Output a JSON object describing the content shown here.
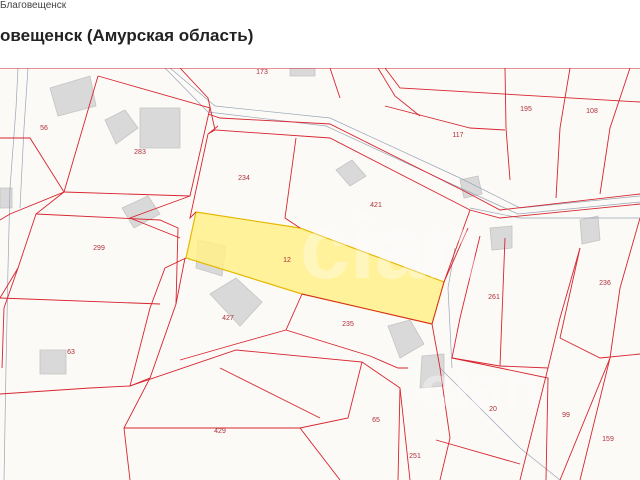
{
  "breadcrumb": "Благовещенск",
  "title": "овещенск (Амурская область)",
  "map": {
    "colors": {
      "parcel_border": "#d8242f",
      "highlight_fill": "#fff08a",
      "highlight_border": "#e6b800",
      "building": "#d9d9d9",
      "road": "#9aa5b8"
    },
    "parcel_labels": [
      "173",
      "195",
      "108",
      "56",
      "283",
      "117",
      "234",
      "421",
      "299",
      "12",
      "261",
      "236",
      "427",
      "235",
      "63",
      "20",
      "99",
      "429",
      "65",
      "159",
      "251"
    ],
    "watermark": "cian"
  }
}
